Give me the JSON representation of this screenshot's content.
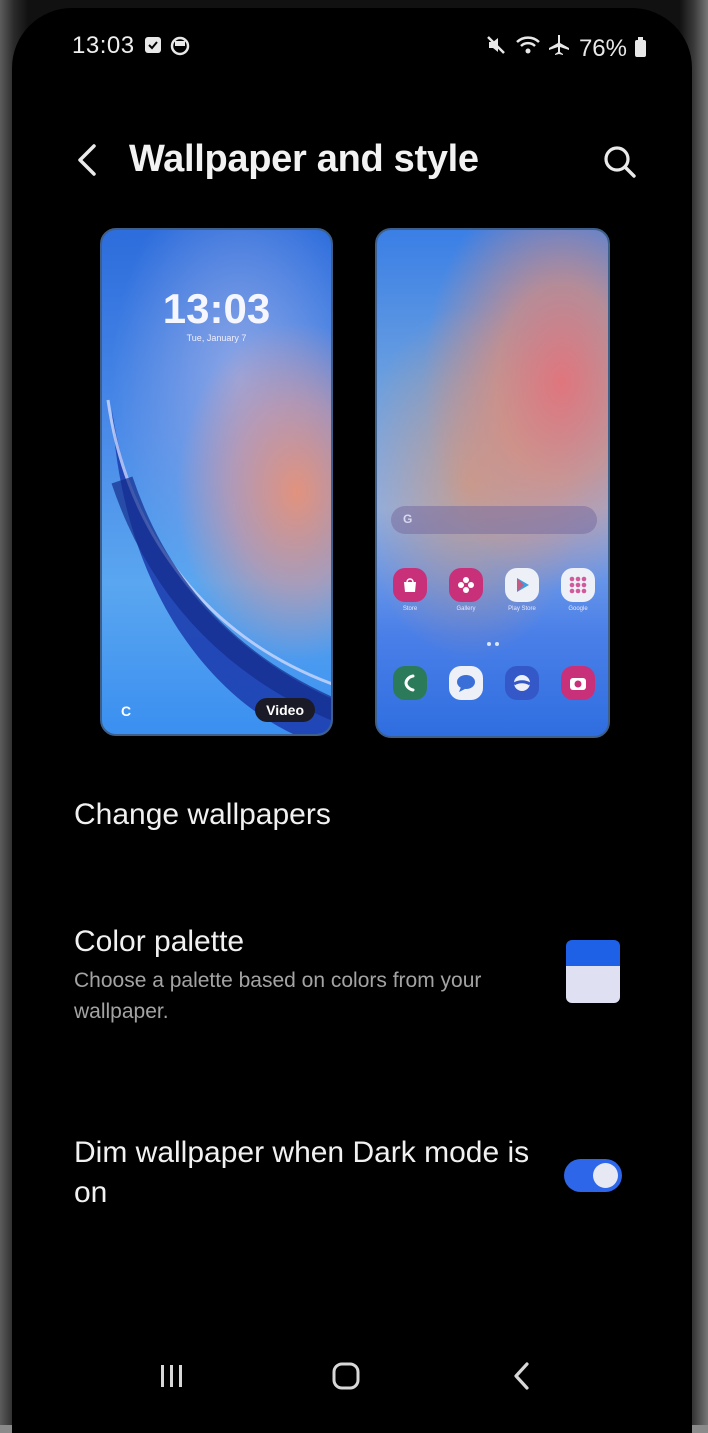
{
  "status_bar": {
    "time": "13:03",
    "battery": "76%",
    "icons": [
      "checkbox-notification-icon",
      "circle-notification-icon",
      "mute-icon",
      "wifi-icon",
      "airplane-icon",
      "battery-icon"
    ]
  },
  "header": {
    "title": "Wallpaper and style"
  },
  "previews": {
    "lock_screen": {
      "clock": "13:03",
      "date": "Tue, January 7",
      "badge": "Video",
      "corner_glyph": "C"
    },
    "home_screen": {
      "search_glyph": "G",
      "apps_row1": [
        {
          "name": "Store",
          "icon": "store-icon",
          "color": "#c8307a"
        },
        {
          "name": "Gallery",
          "icon": "gallery-icon",
          "color": "#c8307a"
        },
        {
          "name": "Play Store",
          "icon": "play-store-icon",
          "color": "#eef0f8"
        },
        {
          "name": "Google",
          "icon": "google-folder-icon",
          "color": "#eef0f8"
        }
      ],
      "apps_row2": [
        {
          "icon": "phone-icon",
          "color": "#2b7a5a"
        },
        {
          "icon": "messages-icon",
          "color": "#eef0f8"
        },
        {
          "icon": "internet-icon",
          "color": "#3458c8"
        },
        {
          "icon": "camera-icon",
          "color": "#c8307a"
        }
      ]
    }
  },
  "settings": {
    "change_wallpapers": "Change wallpapers",
    "color_palette": {
      "title": "Color palette",
      "subtitle": "Choose a palette based on colors from your wallpaper."
    },
    "dim_wallpaper": {
      "title": "Dim wallpaper when Dark mode is on",
      "enabled": true
    }
  },
  "colors": {
    "accent": "#2d66e8",
    "palette_primary": "#1e61e6",
    "palette_secondary": "#dfe0f2"
  }
}
